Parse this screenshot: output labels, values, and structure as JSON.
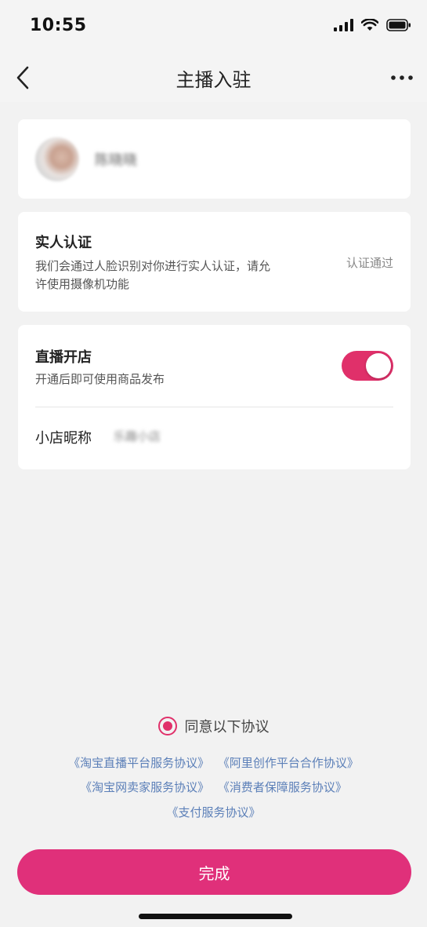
{
  "status_bar": {
    "time": "10:55",
    "icons": [
      "signal-icon",
      "wifi-icon",
      "battery-icon"
    ]
  },
  "nav": {
    "title": "主播入驻",
    "back_icon": "chevron-left-icon",
    "more_icon": "more-dots-icon"
  },
  "profile": {
    "username": "陈晓晓"
  },
  "verification": {
    "title": "实人认证",
    "description_line1": "我们会通过人脸识别对你进行实人认证，请允",
    "description_line2": "许使用摄像机功能",
    "status": "认证通过"
  },
  "live_shop": {
    "title": "直播开店",
    "description": "开通后即可使用商品发布",
    "toggle_on": true,
    "nickname_label": "小店昵称",
    "nickname_value": "乐趣小店"
  },
  "agreement": {
    "checked": true,
    "label": "同意以下协议",
    "links_row1": [
      "《淘宝直播平台服务协议》",
      "《阿里创作平台合作协议》"
    ],
    "links_row2": [
      "《淘宝网卖家服务协议》",
      "《消费者保障服务协议》"
    ],
    "links_row3": [
      "《支付服务协议》"
    ]
  },
  "submit": {
    "label": "完成"
  },
  "colors": {
    "accent": "#e0306a",
    "button": "#e0307a",
    "link": "#5b7fb8",
    "background": "#f2f2f2"
  }
}
